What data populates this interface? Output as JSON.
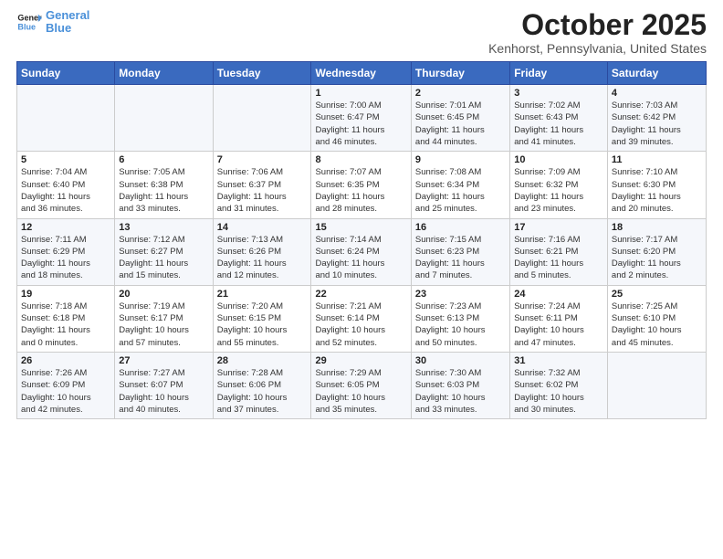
{
  "header": {
    "logo_line1": "General",
    "logo_line2": "Blue",
    "month": "October 2025",
    "location": "Kenhorst, Pennsylvania, United States"
  },
  "days_of_week": [
    "Sunday",
    "Monday",
    "Tuesday",
    "Wednesday",
    "Thursday",
    "Friday",
    "Saturday"
  ],
  "weeks": [
    [
      {
        "num": "",
        "info": ""
      },
      {
        "num": "",
        "info": ""
      },
      {
        "num": "",
        "info": ""
      },
      {
        "num": "1",
        "info": "Sunrise: 7:00 AM\nSunset: 6:47 PM\nDaylight: 11 hours\nand 46 minutes."
      },
      {
        "num": "2",
        "info": "Sunrise: 7:01 AM\nSunset: 6:45 PM\nDaylight: 11 hours\nand 44 minutes."
      },
      {
        "num": "3",
        "info": "Sunrise: 7:02 AM\nSunset: 6:43 PM\nDaylight: 11 hours\nand 41 minutes."
      },
      {
        "num": "4",
        "info": "Sunrise: 7:03 AM\nSunset: 6:42 PM\nDaylight: 11 hours\nand 39 minutes."
      }
    ],
    [
      {
        "num": "5",
        "info": "Sunrise: 7:04 AM\nSunset: 6:40 PM\nDaylight: 11 hours\nand 36 minutes."
      },
      {
        "num": "6",
        "info": "Sunrise: 7:05 AM\nSunset: 6:38 PM\nDaylight: 11 hours\nand 33 minutes."
      },
      {
        "num": "7",
        "info": "Sunrise: 7:06 AM\nSunset: 6:37 PM\nDaylight: 11 hours\nand 31 minutes."
      },
      {
        "num": "8",
        "info": "Sunrise: 7:07 AM\nSunset: 6:35 PM\nDaylight: 11 hours\nand 28 minutes."
      },
      {
        "num": "9",
        "info": "Sunrise: 7:08 AM\nSunset: 6:34 PM\nDaylight: 11 hours\nand 25 minutes."
      },
      {
        "num": "10",
        "info": "Sunrise: 7:09 AM\nSunset: 6:32 PM\nDaylight: 11 hours\nand 23 minutes."
      },
      {
        "num": "11",
        "info": "Sunrise: 7:10 AM\nSunset: 6:30 PM\nDaylight: 11 hours\nand 20 minutes."
      }
    ],
    [
      {
        "num": "12",
        "info": "Sunrise: 7:11 AM\nSunset: 6:29 PM\nDaylight: 11 hours\nand 18 minutes."
      },
      {
        "num": "13",
        "info": "Sunrise: 7:12 AM\nSunset: 6:27 PM\nDaylight: 11 hours\nand 15 minutes."
      },
      {
        "num": "14",
        "info": "Sunrise: 7:13 AM\nSunset: 6:26 PM\nDaylight: 11 hours\nand 12 minutes."
      },
      {
        "num": "15",
        "info": "Sunrise: 7:14 AM\nSunset: 6:24 PM\nDaylight: 11 hours\nand 10 minutes."
      },
      {
        "num": "16",
        "info": "Sunrise: 7:15 AM\nSunset: 6:23 PM\nDaylight: 11 hours\nand 7 minutes."
      },
      {
        "num": "17",
        "info": "Sunrise: 7:16 AM\nSunset: 6:21 PM\nDaylight: 11 hours\nand 5 minutes."
      },
      {
        "num": "18",
        "info": "Sunrise: 7:17 AM\nSunset: 6:20 PM\nDaylight: 11 hours\nand 2 minutes."
      }
    ],
    [
      {
        "num": "19",
        "info": "Sunrise: 7:18 AM\nSunset: 6:18 PM\nDaylight: 11 hours\nand 0 minutes."
      },
      {
        "num": "20",
        "info": "Sunrise: 7:19 AM\nSunset: 6:17 PM\nDaylight: 10 hours\nand 57 minutes."
      },
      {
        "num": "21",
        "info": "Sunrise: 7:20 AM\nSunset: 6:15 PM\nDaylight: 10 hours\nand 55 minutes."
      },
      {
        "num": "22",
        "info": "Sunrise: 7:21 AM\nSunset: 6:14 PM\nDaylight: 10 hours\nand 52 minutes."
      },
      {
        "num": "23",
        "info": "Sunrise: 7:23 AM\nSunset: 6:13 PM\nDaylight: 10 hours\nand 50 minutes."
      },
      {
        "num": "24",
        "info": "Sunrise: 7:24 AM\nSunset: 6:11 PM\nDaylight: 10 hours\nand 47 minutes."
      },
      {
        "num": "25",
        "info": "Sunrise: 7:25 AM\nSunset: 6:10 PM\nDaylight: 10 hours\nand 45 minutes."
      }
    ],
    [
      {
        "num": "26",
        "info": "Sunrise: 7:26 AM\nSunset: 6:09 PM\nDaylight: 10 hours\nand 42 minutes."
      },
      {
        "num": "27",
        "info": "Sunrise: 7:27 AM\nSunset: 6:07 PM\nDaylight: 10 hours\nand 40 minutes."
      },
      {
        "num": "28",
        "info": "Sunrise: 7:28 AM\nSunset: 6:06 PM\nDaylight: 10 hours\nand 37 minutes."
      },
      {
        "num": "29",
        "info": "Sunrise: 7:29 AM\nSunset: 6:05 PM\nDaylight: 10 hours\nand 35 minutes."
      },
      {
        "num": "30",
        "info": "Sunrise: 7:30 AM\nSunset: 6:03 PM\nDaylight: 10 hours\nand 33 minutes."
      },
      {
        "num": "31",
        "info": "Sunrise: 7:32 AM\nSunset: 6:02 PM\nDaylight: 10 hours\nand 30 minutes."
      },
      {
        "num": "",
        "info": ""
      }
    ]
  ]
}
